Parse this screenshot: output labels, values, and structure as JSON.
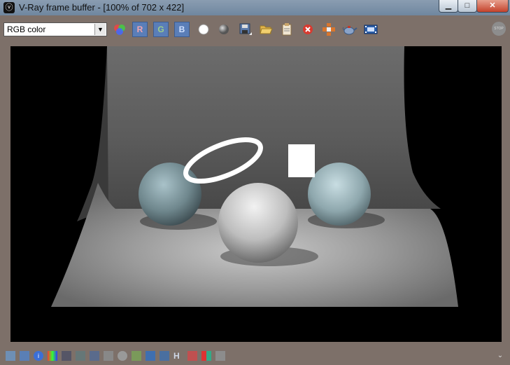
{
  "window": {
    "title": "V-Ray frame buffer - [100% of 702 x 422]",
    "app_icon": "vray-icon",
    "controls": {
      "minimize": "▁",
      "maximize": "□",
      "close": "✕"
    }
  },
  "toolbar": {
    "channel_select": {
      "value": "RGB color"
    },
    "channel_buttons": {
      "r": "R",
      "g": "G",
      "b": "B"
    },
    "stop_label": "STOP"
  },
  "status_h": "H",
  "colors": {
    "frame": "#7d7069",
    "channel_button": "#5a7eb8"
  }
}
